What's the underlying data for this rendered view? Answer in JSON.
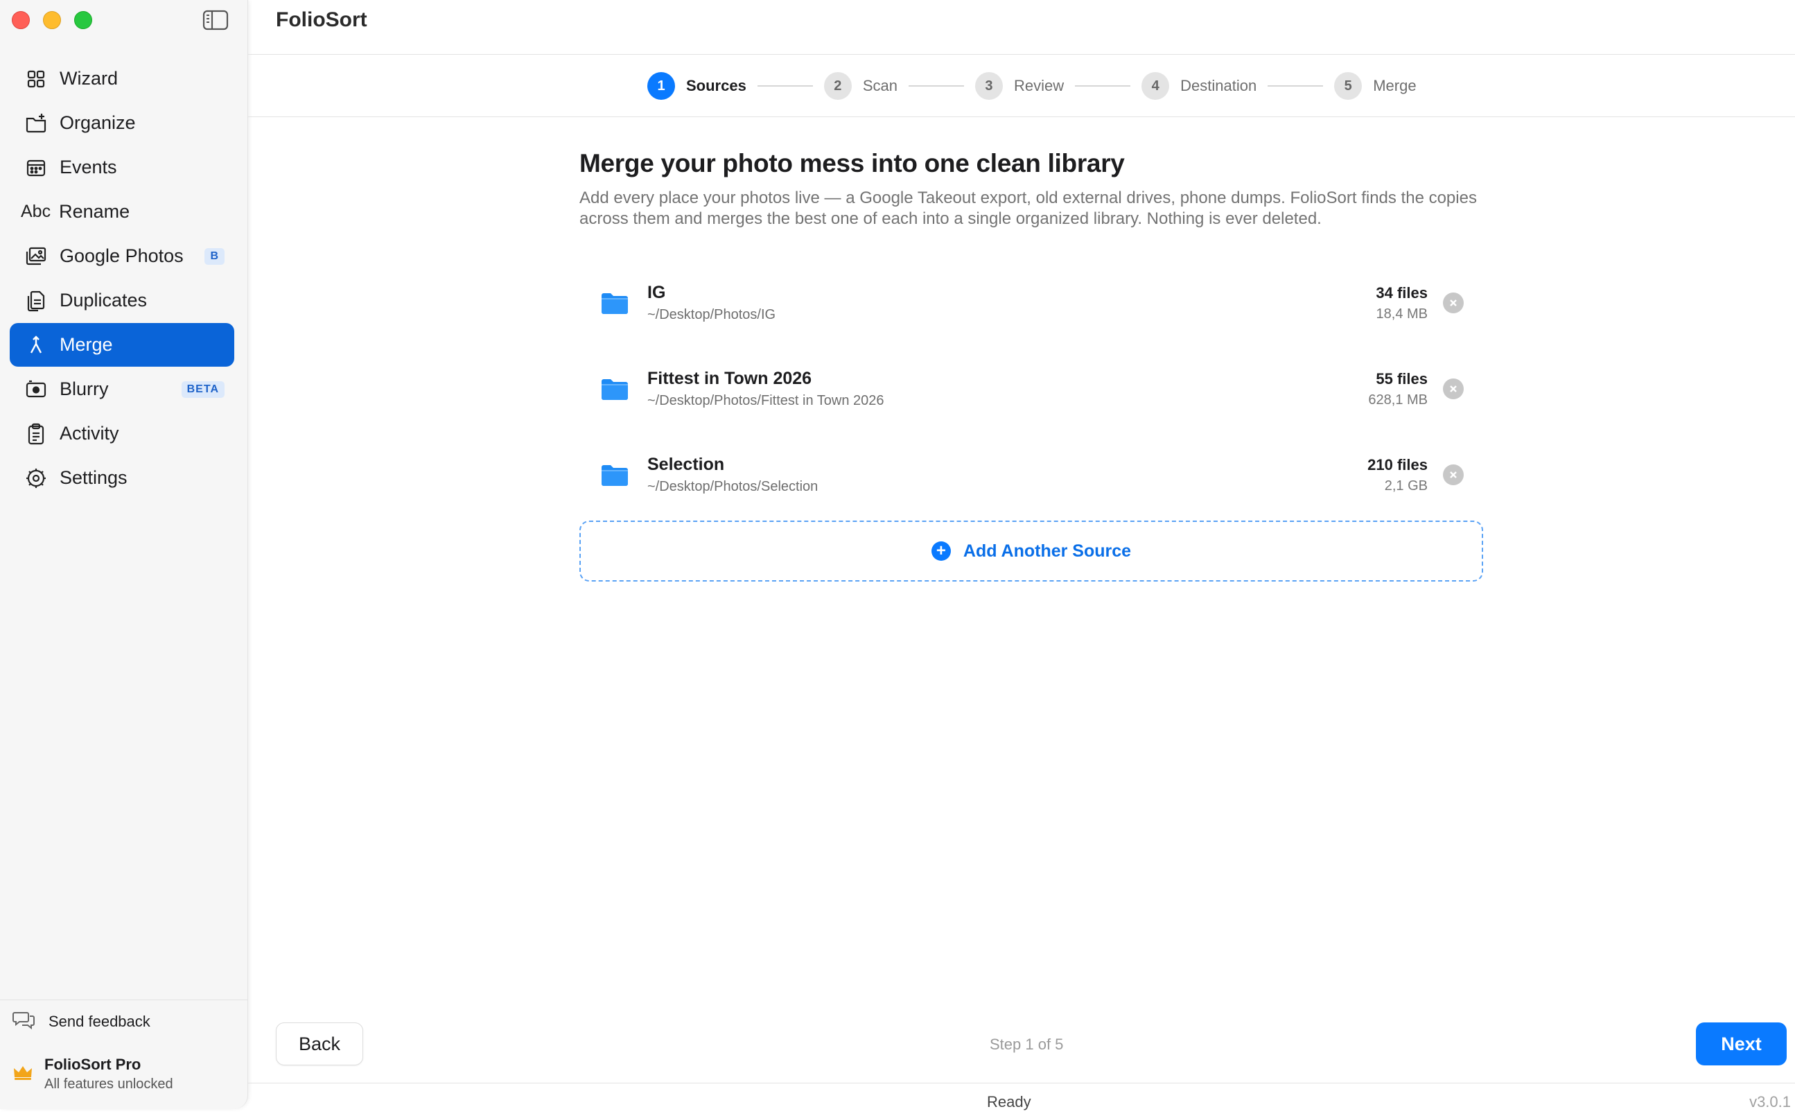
{
  "app": {
    "title": "FolioSort",
    "version": "v3.0.1",
    "status": "Ready"
  },
  "sidebar": {
    "items": [
      {
        "label": "Wizard",
        "icon": "grid-icon"
      },
      {
        "label": "Organize",
        "icon": "folder-organize-icon"
      },
      {
        "label": "Events",
        "icon": "calendar-icon"
      },
      {
        "label": "Rename",
        "icon": "abc-icon",
        "icon_text": "Abc"
      },
      {
        "label": "Google Photos",
        "icon": "photos-icon",
        "badge": "B"
      },
      {
        "label": "Duplicates",
        "icon": "duplicate-icon"
      },
      {
        "label": "Merge",
        "icon": "merge-icon",
        "active": true
      },
      {
        "label": "Blurry",
        "icon": "camera-icon",
        "badge": "BETA"
      },
      {
        "label": "Activity",
        "icon": "clipboard-icon"
      },
      {
        "label": "Settings",
        "icon": "gear-icon"
      }
    ],
    "feedback": "Send feedback",
    "pro": {
      "title": "FolioSort Pro",
      "subtitle": "All features unlocked"
    }
  },
  "stepper": [
    {
      "num": "1",
      "label": "Sources",
      "active": true
    },
    {
      "num": "2",
      "label": "Scan"
    },
    {
      "num": "3",
      "label": "Review"
    },
    {
      "num": "4",
      "label": "Destination"
    },
    {
      "num": "5",
      "label": "Merge"
    }
  ],
  "main": {
    "heading": "Merge your photo mess into one clean library",
    "description": "Add every place your photos live — a Google Takeout export, old external drives, phone dumps. FolioSort finds the copies across them and merges the best one of each into a single organized library. Nothing is ever deleted.",
    "sources": [
      {
        "name": "IG",
        "path": "~/Desktop/Photos/IG",
        "count": "34 files",
        "size": "18,4 MB"
      },
      {
        "name": "Fittest in Town 2026",
        "path": "~/Desktop/Photos/Fittest in Town 2026",
        "count": "55 files",
        "size": "628,1 MB"
      },
      {
        "name": "Selection",
        "path": "~/Desktop/Photos/Selection",
        "count": "210 files",
        "size": "2,1 GB"
      }
    ],
    "add_source": "Add Another Source"
  },
  "footer": {
    "back": "Back",
    "step_indicator": "Step 1 of 5",
    "next": "Next"
  },
  "colors": {
    "accent": "#0a7aff",
    "sidebar_active": "#0a64d8"
  }
}
